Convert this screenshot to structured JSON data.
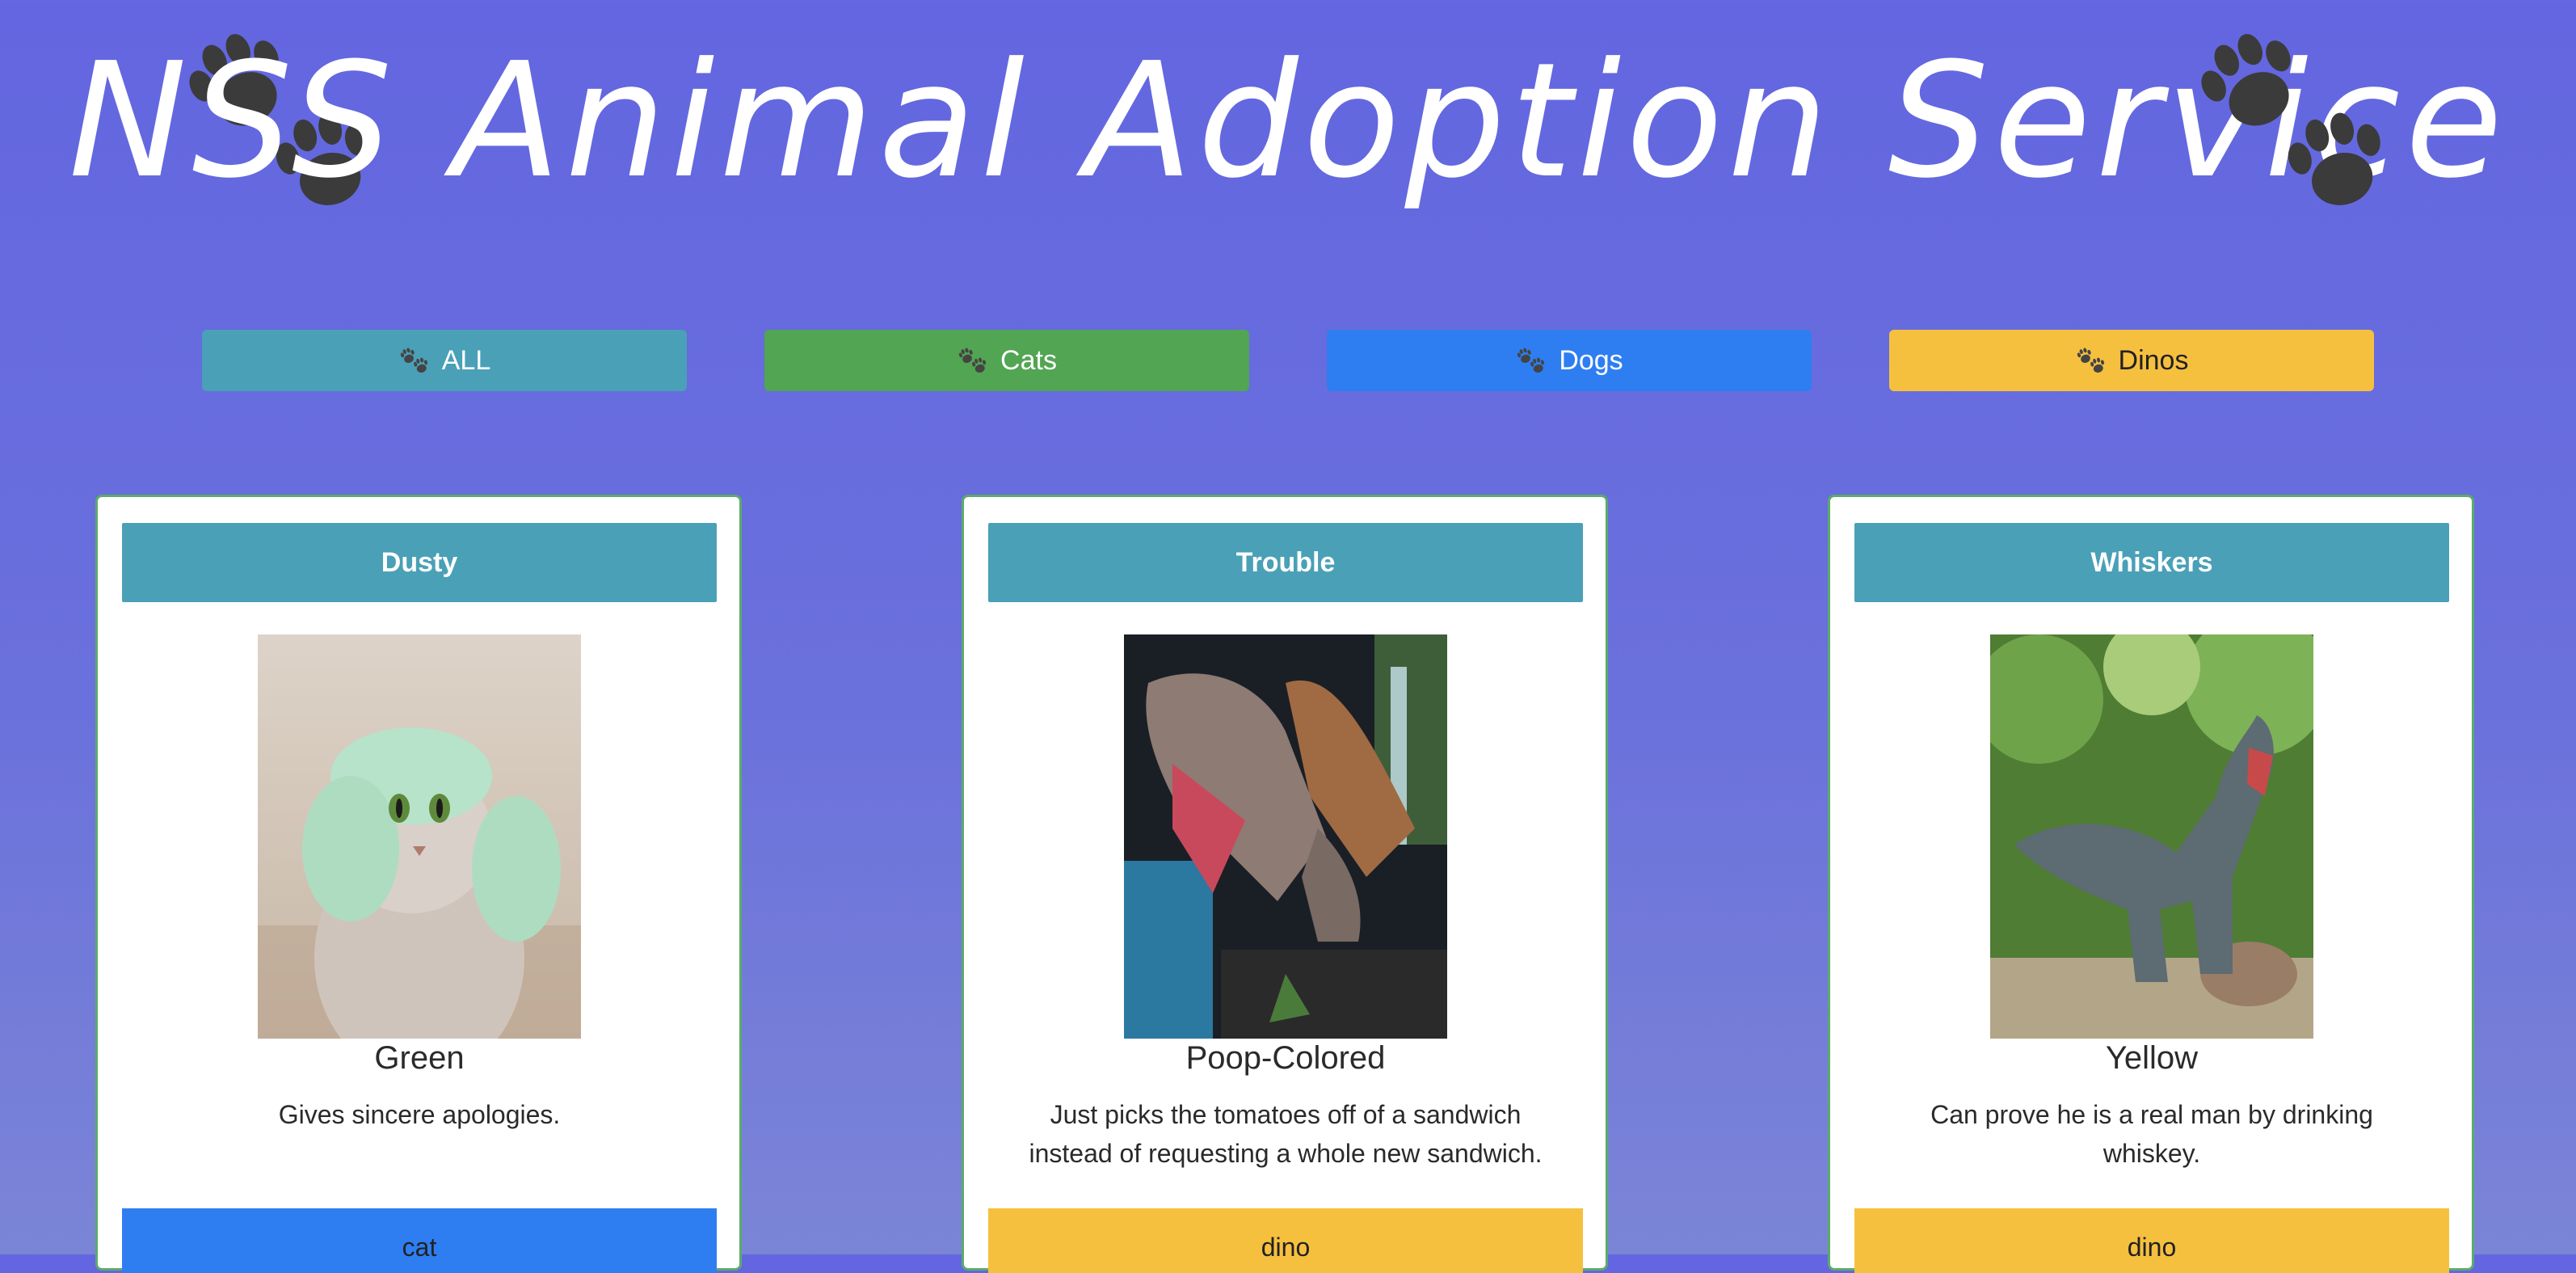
{
  "header": {
    "title": "NSS Animal Adoption Service",
    "left_icon": "paw-prints-icon",
    "right_icon": "paw-prints-icon"
  },
  "filters": {
    "icon": "paw-icon",
    "buttons": [
      {
        "label": "ALL",
        "color": "#4aa0b7"
      },
      {
        "label": "Cats",
        "color": "#52a552"
      },
      {
        "label": "Dogs",
        "color": "#2e7ef2"
      },
      {
        "label": "Dinos",
        "color": "#f6c03f"
      }
    ]
  },
  "pets": [
    {
      "name": "Dusty",
      "color": "Green",
      "skill": "Gives sincere apologies.",
      "type": "cat",
      "type_color": "#2e7ef2"
    },
    {
      "name": "Trouble",
      "color": "Poop-Colored",
      "skill": "Just picks the tomatoes off of a sandwich instead of requesting a whole new sandwich.",
      "type": "dino",
      "type_color": "#f6c03f"
    },
    {
      "name": "Whiskers",
      "color": "Yellow",
      "skill": "Can prove he is a real man by drinking whiskey.",
      "type": "dino",
      "type_color": "#f6c03f"
    }
  ],
  "colors": {
    "background": "#6366e0",
    "card_header": "#4aa0b7",
    "card_border": "#5bab6a"
  }
}
